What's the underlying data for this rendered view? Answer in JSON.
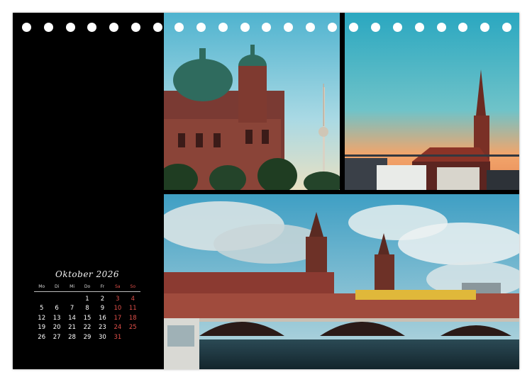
{
  "calendar": {
    "month_label": "Oktober 2026",
    "weekdays": [
      "Mo",
      "Di",
      "Mi",
      "Do",
      "Fr",
      "Sa",
      "So"
    ],
    "leading_blanks": 3,
    "days": [
      "1",
      "2",
      "3",
      "4",
      "5",
      "6",
      "7",
      "8",
      "9",
      "10",
      "11",
      "12",
      "13",
      "14",
      "15",
      "16",
      "17",
      "18",
      "19",
      "20",
      "21",
      "22",
      "23",
      "24",
      "25",
      "26",
      "27",
      "28",
      "29",
      "30",
      "31"
    ],
    "highlight_columns": [
      5,
      6
    ],
    "highlight_color": "#e2504a"
  },
  "photos": [
    {
      "subject": "cathedral-tv-tower"
    },
    {
      "subject": "church-spire-sunset"
    },
    {
      "subject": "bridge-with-towers"
    }
  ],
  "binding_holes": 23,
  "colors": {
    "page_background": "#000000",
    "paper": "#ffffff"
  }
}
